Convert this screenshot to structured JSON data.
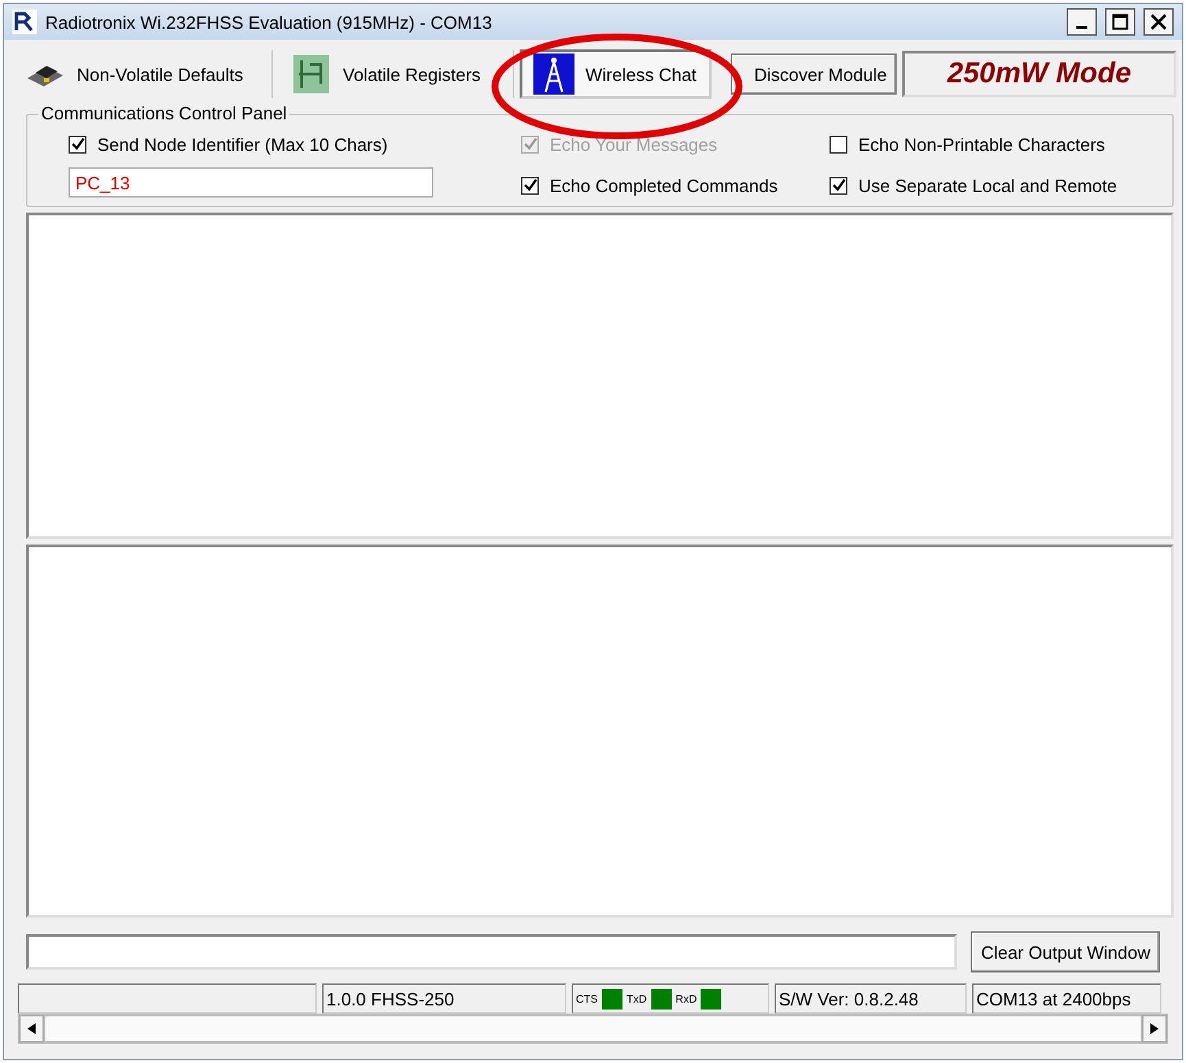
{
  "window": {
    "title": "Radiotronix Wi.232FHSS Evaluation (915MHz) - COM13"
  },
  "tabs": [
    {
      "label": "Non-Volatile Defaults",
      "selected": false,
      "kind": "chip"
    },
    {
      "label": "Volatile Registers",
      "selected": false,
      "kind": "board"
    },
    {
      "label": "Wireless Chat",
      "selected": true,
      "kind": "tower"
    }
  ],
  "discover_button": "Discover Module",
  "mode_label": "250mW Mode",
  "control_panel": {
    "title": "Communications Control Panel",
    "options": [
      {
        "label": "Send Node Identifier (Max 10 Chars)",
        "checked": true,
        "disabled": false
      },
      {
        "label": "Echo Your Messages",
        "checked": true,
        "disabled": true
      },
      {
        "label": "Echo Non-Printable Characters",
        "checked": false,
        "disabled": false
      },
      {
        "label": "Echo Completed Commands",
        "checked": true,
        "disabled": false
      },
      {
        "label": "Use Separate Local and Remote",
        "checked": true,
        "disabled": false
      }
    ],
    "node_id": "PC_13"
  },
  "clear_button": "Clear Output Window",
  "status_bar": {
    "version": "1.0.0 FHSS-250",
    "lines": [
      {
        "label": "CTS",
        "on": true
      },
      {
        "label": "TxD",
        "on": true
      },
      {
        "label": "RxD",
        "on": true
      }
    ],
    "software": "S/W Ver: 0.8.2.48",
    "port": "COM13 at 2400bps"
  }
}
